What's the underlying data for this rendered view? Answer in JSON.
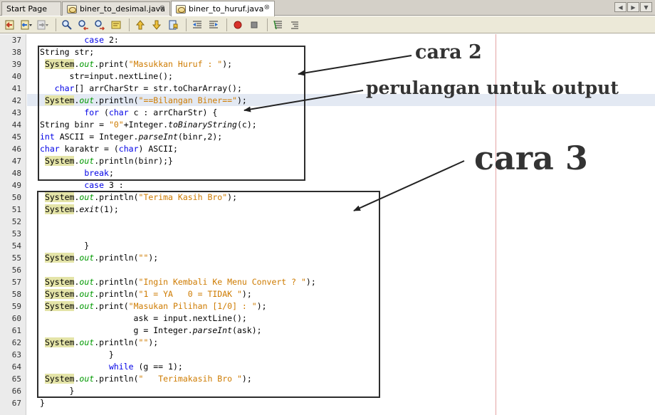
{
  "tabs": [
    {
      "label": "Start Page"
    },
    {
      "label": "biner_to_desimal.java"
    },
    {
      "label": "biner_to_huruf.java"
    }
  ],
  "tab_close_glyph": "⊗",
  "tab_nav": {
    "left": "◀",
    "right": "▶",
    "menu": "▼"
  },
  "toolbar_icons": [
    "back-icon",
    "back-dropdown-icon",
    "forward-icon",
    "forward-dropdown-icon",
    "find-icon",
    "find-prev-icon",
    "find-next-icon",
    "toggle-highlight-icon",
    "prev-bookmark-icon",
    "next-bookmark-icon",
    "toggle-bookmark-icon",
    "shift-left-icon",
    "shift-right-icon",
    "start-macro-icon",
    "stop-macro-icon",
    "comment-icon",
    "uncomment-icon"
  ],
  "line_numbers": [
    "37",
    "38",
    "39",
    "40",
    "41",
    "42",
    "43",
    "44",
    "45",
    "46",
    "47",
    "48",
    "49",
    "50",
    "51",
    "52",
    "53",
    "54",
    "55",
    "56",
    "57",
    "58",
    "59",
    "60",
    "61",
    "62",
    "63",
    "64",
    "65",
    "66",
    "67"
  ],
  "annotations": {
    "cara2": "cara 2",
    "perulangan": "perulangan untuk output",
    "cara3": "cara 3"
  },
  "colors": {
    "keyword": "#0000e6",
    "string": "#ce7b00",
    "system_highlight": "#e4e4a8",
    "annotation": "#333333",
    "margin_line": "#e3a3a3"
  },
  "code": [
    [
      {
        "t": "         "
      },
      {
        "t": "case",
        "c": "kw"
      },
      {
        "t": " 2:"
      }
    ],
    [
      {
        "t": "String str;"
      }
    ],
    [
      {
        "t": " "
      },
      {
        "t": "System",
        "c": "sys"
      },
      {
        "t": "."
      },
      {
        "t": "out",
        "c": "fld"
      },
      {
        "t": ".print("
      },
      {
        "t": "\"Masukkan Huruf : \"",
        "c": "str"
      },
      {
        "t": ");"
      }
    ],
    [
      {
        "t": "      str=input.nextLine();"
      }
    ],
    [
      {
        "t": "   "
      },
      {
        "t": "char",
        "c": "kw"
      },
      {
        "t": "[] arrCharStr = str.toCharArray();"
      }
    ],
    [
      {
        "t": " "
      },
      {
        "t": "System",
        "c": "sys"
      },
      {
        "t": "."
      },
      {
        "t": "out",
        "c": "fld"
      },
      {
        "t": ".println("
      },
      {
        "t": "\"==Bilangan Biner==\"",
        "c": "str"
      },
      {
        "t": ");"
      }
    ],
    [
      {
        "t": "         "
      },
      {
        "t": "for",
        "c": "kw"
      },
      {
        "t": " ("
      },
      {
        "t": "char",
        "c": "kw"
      },
      {
        "t": " c : arrCharStr) {"
      }
    ],
    [
      {
        "t": "String binr = "
      },
      {
        "t": "\"0\"",
        "c": "str"
      },
      {
        "t": "+Integer."
      },
      {
        "t": "toBinaryString",
        "c": "it"
      },
      {
        "t": "(c);"
      }
    ],
    [
      {
        "t": "int",
        "c": "kw"
      },
      {
        "t": " ASCII = Integer."
      },
      {
        "t": "parseInt",
        "c": "it"
      },
      {
        "t": "(binr,2);"
      }
    ],
    [
      {
        "t": "char",
        "c": "kw"
      },
      {
        "t": " karaktr = ("
      },
      {
        "t": "char",
        "c": "kw"
      },
      {
        "t": ") ASCII;"
      }
    ],
    [
      {
        "t": " "
      },
      {
        "t": "System",
        "c": "sys"
      },
      {
        "t": "."
      },
      {
        "t": "out",
        "c": "fld"
      },
      {
        "t": ".println(binr);}"
      }
    ],
    [
      {
        "t": "         "
      },
      {
        "t": "break",
        "c": "kw"
      },
      {
        "t": ";"
      }
    ],
    [
      {
        "t": "         "
      },
      {
        "t": "case",
        "c": "kw"
      },
      {
        "t": " 3 :"
      }
    ],
    [
      {
        "t": " "
      },
      {
        "t": "System",
        "c": "sys"
      },
      {
        "t": "."
      },
      {
        "t": "out",
        "c": "fld"
      },
      {
        "t": ".println("
      },
      {
        "t": "\"Terima Kasih Bro\"",
        "c": "str"
      },
      {
        "t": ");"
      }
    ],
    [
      {
        "t": " "
      },
      {
        "t": "System",
        "c": "sys"
      },
      {
        "t": "."
      },
      {
        "t": "exit",
        "c": "it"
      },
      {
        "t": "(1);"
      }
    ],
    [
      {
        "t": ""
      }
    ],
    [
      {
        "t": ""
      }
    ],
    [
      {
        "t": "         }"
      }
    ],
    [
      {
        "t": " "
      },
      {
        "t": "System",
        "c": "sys"
      },
      {
        "t": "."
      },
      {
        "t": "out",
        "c": "fld"
      },
      {
        "t": ".println("
      },
      {
        "t": "\"\"",
        "c": "str"
      },
      {
        "t": ");"
      }
    ],
    [
      {
        "t": ""
      }
    ],
    [
      {
        "t": " "
      },
      {
        "t": "System",
        "c": "sys"
      },
      {
        "t": "."
      },
      {
        "t": "out",
        "c": "fld"
      },
      {
        "t": ".println("
      },
      {
        "t": "\"Ingin Kembali Ke Menu Convert ? \"",
        "c": "str"
      },
      {
        "t": ");"
      }
    ],
    [
      {
        "t": " "
      },
      {
        "t": "System",
        "c": "sys"
      },
      {
        "t": "."
      },
      {
        "t": "out",
        "c": "fld"
      },
      {
        "t": ".println("
      },
      {
        "t": "\"1 = YA   0 = TIDAK \"",
        "c": "str"
      },
      {
        "t": ");"
      }
    ],
    [
      {
        "t": " "
      },
      {
        "t": "System",
        "c": "sys"
      },
      {
        "t": "."
      },
      {
        "t": "out",
        "c": "fld"
      },
      {
        "t": ".print("
      },
      {
        "t": "\"Masukan Pilihan [1/0] : \"",
        "c": "str"
      },
      {
        "t": ");"
      }
    ],
    [
      {
        "t": "                   ask = input.nextLine();"
      }
    ],
    [
      {
        "t": "                   g = Integer."
      },
      {
        "t": "parseInt",
        "c": "it"
      },
      {
        "t": "(ask);"
      }
    ],
    [
      {
        "t": " "
      },
      {
        "t": "System",
        "c": "sys"
      },
      {
        "t": "."
      },
      {
        "t": "out",
        "c": "fld"
      },
      {
        "t": ".println("
      },
      {
        "t": "\"\"",
        "c": "str"
      },
      {
        "t": ");"
      }
    ],
    [
      {
        "t": "              }"
      }
    ],
    [
      {
        "t": "              "
      },
      {
        "t": "while",
        "c": "kw"
      },
      {
        "t": " (g == 1);"
      }
    ],
    [
      {
        "t": " "
      },
      {
        "t": "System",
        "c": "sys"
      },
      {
        "t": "."
      },
      {
        "t": "out",
        "c": "fld"
      },
      {
        "t": ".println("
      },
      {
        "t": "\"   Terimakasih Bro \"",
        "c": "str"
      },
      {
        "t": ");"
      }
    ],
    [
      {
        "t": "      }"
      }
    ],
    [
      {
        "t": "}"
      }
    ]
  ]
}
